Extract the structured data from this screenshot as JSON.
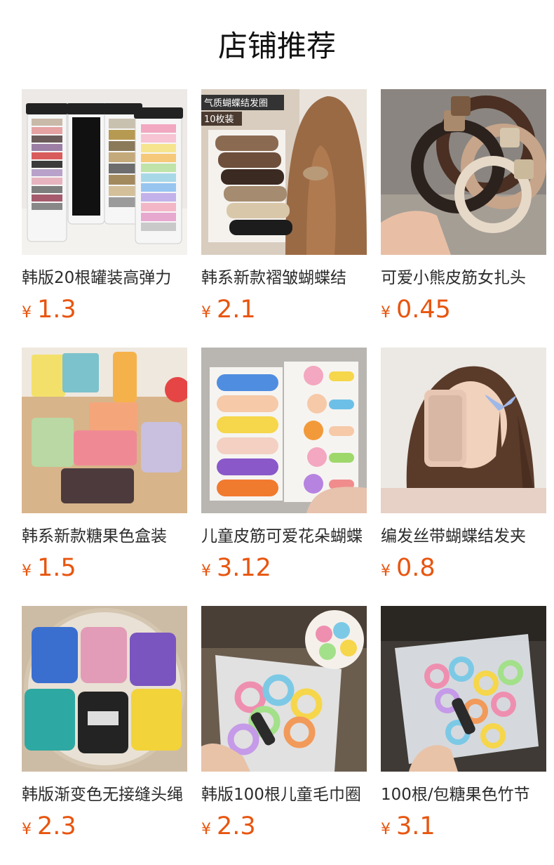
{
  "page": {
    "title": "店铺推荐"
  },
  "colors": {
    "price": "#e8550f",
    "title": "#111111",
    "text": "#2b2b2b"
  },
  "products": [
    {
      "name": "韩版20根罐装高弹力",
      "currency": "¥",
      "price": "1.3"
    },
    {
      "name": "韩系新款褶皱蝴蝶结",
      "currency": "¥",
      "price": "2.1",
      "image_caption": "气质蝴蝶结发圈",
      "image_badge": "10枚装"
    },
    {
      "name": "可爱小熊皮筋女扎头",
      "currency": "¥",
      "price": "0.45"
    },
    {
      "name": "韩系新款糖果色盒装",
      "currency": "¥",
      "price": "1.5"
    },
    {
      "name": "儿童皮筋可爱花朵蝴蝶",
      "currency": "¥",
      "price": "3.12"
    },
    {
      "name": "编发丝带蝴蝶结发夹",
      "currency": "¥",
      "price": "0.8"
    },
    {
      "name": "韩版渐变色无接缝头绳",
      "currency": "¥",
      "price": "2.3"
    },
    {
      "name": "韩版100根儿童毛巾圈",
      "currency": "¥",
      "price": "2.3"
    },
    {
      "name": "100根/包糖果色竹节",
      "currency": "¥",
      "price": "3.1"
    }
  ]
}
